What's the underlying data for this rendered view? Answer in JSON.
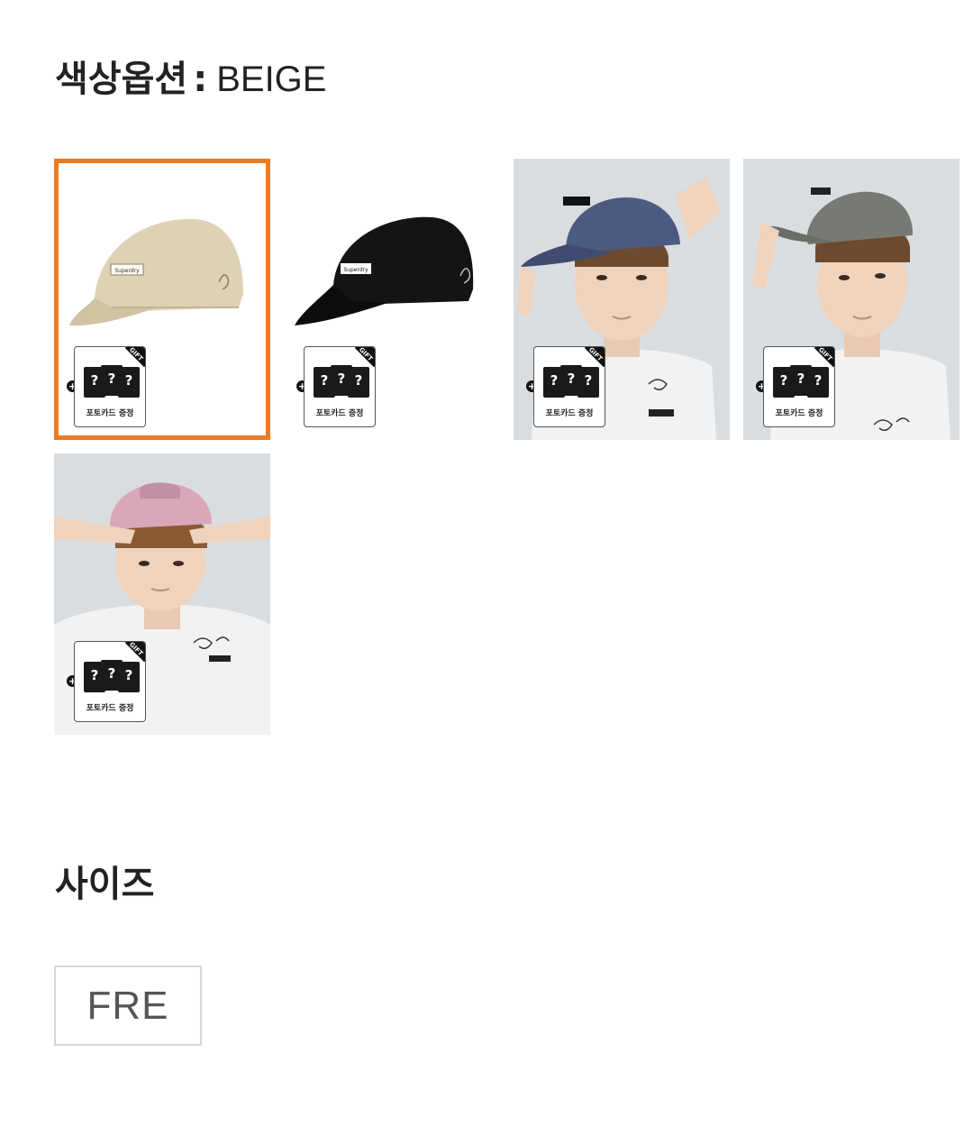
{
  "color_option": {
    "label": "색상옵션",
    "separator": ":",
    "selected_value": "BEIGE",
    "swatches": [
      {
        "name": "beige",
        "image": "beige-cap-product",
        "selected": true
      },
      {
        "name": "black",
        "image": "black-cap-product",
        "selected": false
      },
      {
        "name": "navy",
        "image": "model-navy-cap",
        "selected": false
      },
      {
        "name": "charcoal",
        "image": "model-gray-cap",
        "selected": false
      },
      {
        "name": "pink",
        "image": "model-pink-cap",
        "selected": false
      }
    ],
    "gift_badge": {
      "corner": "GIFT",
      "caption": "포토카드 증정",
      "card_mark": "?",
      "plus": "+"
    },
    "cap_logo": "Superdry",
    "colors": {
      "selected_border": "#ee7a22",
      "beige": "#ddd2b4",
      "black": "#141414",
      "navy": "#4c5a82",
      "charcoal": "#777a72",
      "pink": "#d9a7b8",
      "photo_bg": "#d9dde0"
    }
  },
  "size_option": {
    "label": "사이즈",
    "options": [
      "FRE"
    ]
  }
}
